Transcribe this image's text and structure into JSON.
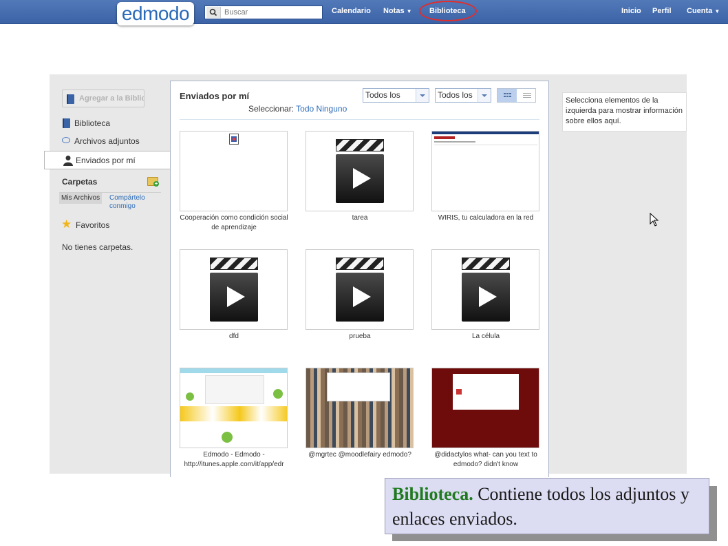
{
  "topbar": {
    "logo": "edmodo",
    "search_placeholder": "Buscar",
    "nav": [
      "Calendario",
      "Notas",
      "Biblioteca"
    ],
    "right_nav": [
      "Inicio",
      "Perfil",
      "Cuenta"
    ]
  },
  "sidebar": {
    "add_button": "Agregar a la Biblioteca",
    "items": [
      "Biblioteca",
      "Archivos adjuntos",
      "Enviados por mí"
    ],
    "folders_title": "Carpetas",
    "tabs": [
      "Mis Archivos",
      "Compártelo conmigo"
    ],
    "favorites": "Favoritos",
    "no_folders": "No tienes carpetas."
  },
  "main": {
    "title": "Enviados por mí",
    "select_label": "Seleccionar:",
    "select_all": "Todo",
    "select_none": "Ninguno",
    "filter1": "Todos los",
    "filter2": "Todos los",
    "items": [
      {
        "caption": "Cooperación como condición social de aprendizaje",
        "thumb": "doc-icon"
      },
      {
        "caption": "tarea",
        "thumb": "video-icon"
      },
      {
        "caption": "WIRIS, tu calculadora en la red",
        "thumb": "webpage"
      },
      {
        "caption": "dfd",
        "thumb": "video-icon"
      },
      {
        "caption": "prueba",
        "thumb": "video-icon"
      },
      {
        "caption": "La célula",
        "thumb": "video-icon"
      },
      {
        "caption": "Edmodo - Edmodo - http://itunes.apple.com/it/app/edr",
        "thumb": "twitter-lemons"
      },
      {
        "caption": "@mgrtec @moodlefairy edmodo?",
        "thumb": "twitter-avatars"
      },
      {
        "caption": "@didactylos what- can you text to edmodo? didn't know",
        "thumb": "twitter-red"
      }
    ]
  },
  "info_panel": {
    "text": "Selecciona elementos de la izquierda para mostrar información sobre ellos aquí."
  },
  "callout": {
    "bold": "Biblioteca.",
    "text": " Contiene todos los adjuntos y enlaces enviados."
  },
  "colors": {
    "topbar": "#3b63a6",
    "link": "#2a6ab8",
    "highlight_oval": "#e32c2c",
    "callout_bold": "#1f7a1f"
  }
}
